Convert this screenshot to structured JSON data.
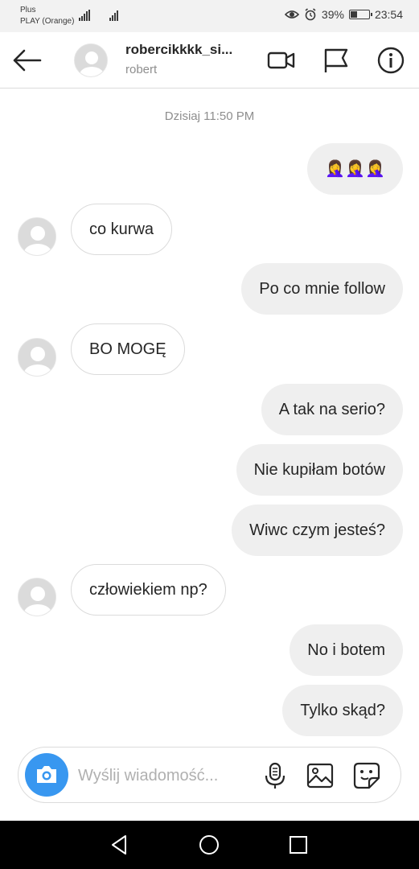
{
  "status": {
    "carrier_line1": "Plus",
    "carrier_line2": "PLAY (Orange)",
    "battery_percent": "39%",
    "battery_level": 0.39,
    "time": "23:54"
  },
  "header": {
    "username": "robercikkkk_si...",
    "real_name": "robert",
    "icons": [
      "back-arrow-icon",
      "video-call-icon",
      "flag-icon",
      "info-icon"
    ]
  },
  "chat": {
    "timestamp": "Dzisiaj 11:50 PM",
    "messages": [
      {
        "side": "out",
        "text": "🤦‍♀️🤦‍♀️🤦‍♀️"
      },
      {
        "side": "in",
        "text": "co kurwa"
      },
      {
        "side": "out",
        "text": "Po co mnie follow"
      },
      {
        "side": "in",
        "text": "BO MOGĘ"
      },
      {
        "side": "out",
        "text": "A tak na serio?"
      },
      {
        "side": "out",
        "text": "Nie kupiłam botów"
      },
      {
        "side": "out",
        "text": "Wiwc czym jesteś?"
      },
      {
        "side": "in",
        "text": "człowiekiem np?"
      },
      {
        "side": "out",
        "text": "No i botem"
      },
      {
        "side": "out",
        "text": "Tylko skąd?"
      }
    ]
  },
  "composer": {
    "placeholder": "Wyślij wiadomość...",
    "icons": [
      "camera-icon",
      "microphone-icon",
      "gallery-icon",
      "sticker-icon"
    ]
  },
  "nav": {
    "icons": [
      "nav-back-icon",
      "nav-home-icon",
      "nav-recents-icon"
    ]
  },
  "colors": {
    "accent": "#3897f0",
    "outgoing_bubble": "#efefef",
    "muted_text": "#8e8e8e"
  }
}
